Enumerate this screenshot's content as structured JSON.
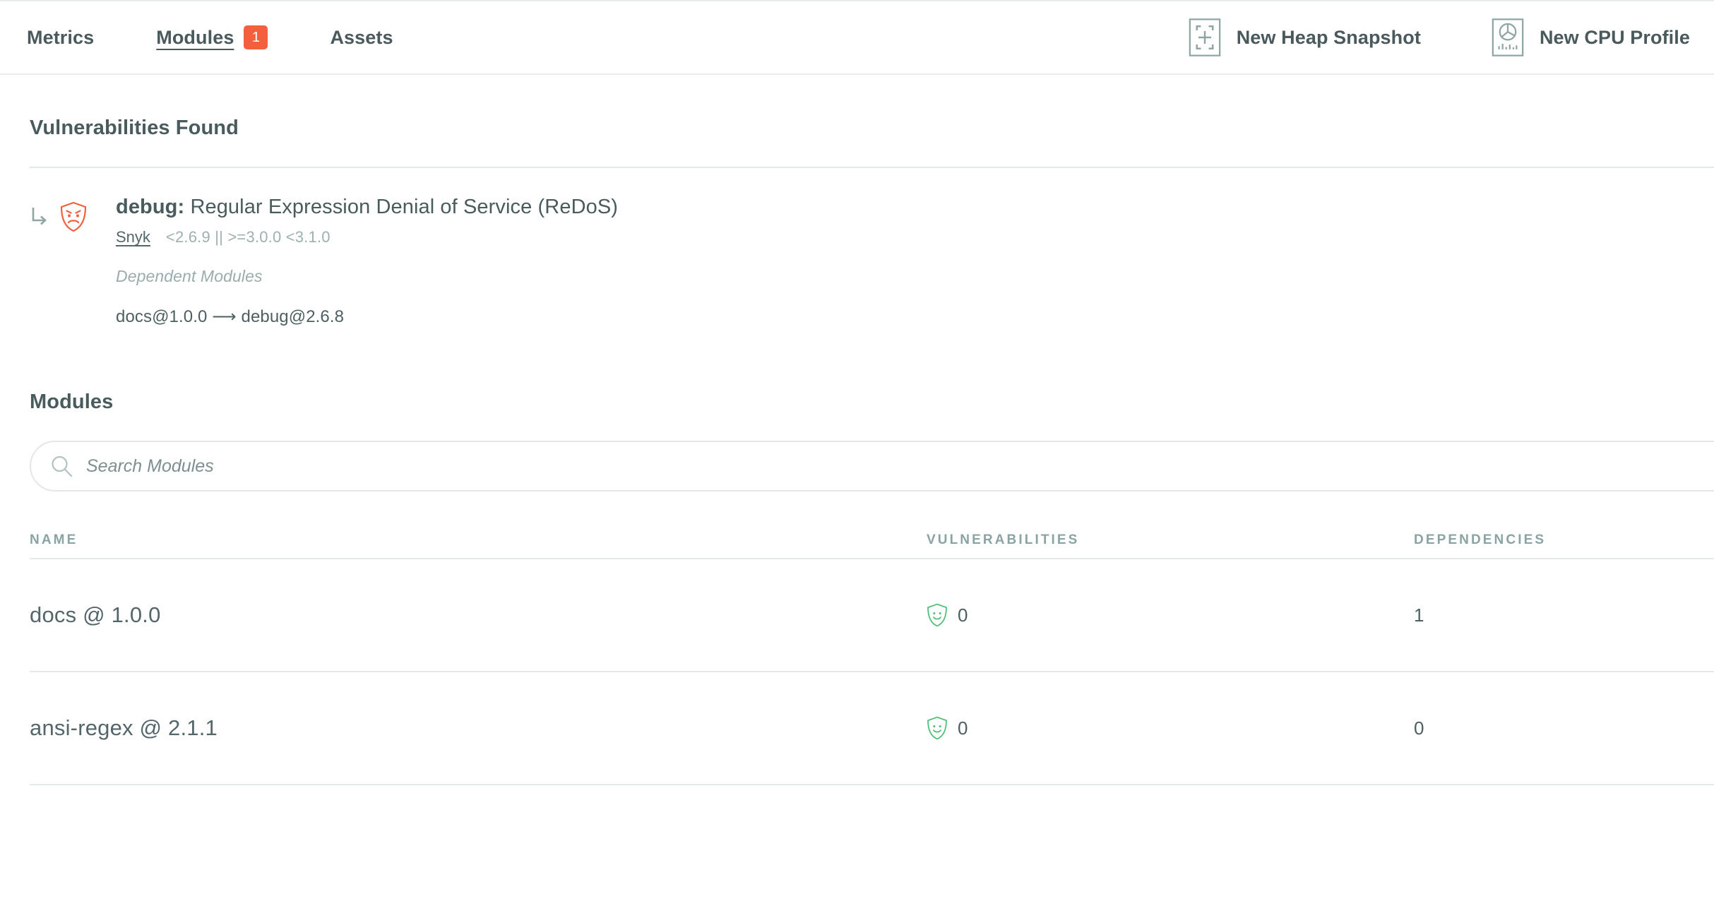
{
  "toolbar": {
    "tabs": [
      {
        "label": "Metrics",
        "active": false,
        "badge": null
      },
      {
        "label": "Modules",
        "active": true,
        "badge": "1"
      },
      {
        "label": "Assets",
        "active": false,
        "badge": null
      }
    ],
    "actions": [
      {
        "label": "New Heap Snapshot",
        "icon": "heap-snapshot-icon"
      },
      {
        "label": "New CPU Profile",
        "icon": "cpu-profile-icon"
      }
    ],
    "badge_color": "#f4603e"
  },
  "vulnerabilities_section": {
    "title": "Vulnerabilities Found",
    "items": [
      {
        "module": "debug",
        "separator": ":",
        "title": "Regular Expression Denial of Service (ReDoS)",
        "source": "Snyk",
        "version_range": "<2.6.9 || >=3.0.0 <3.1.0",
        "dependent_modules_label": "Dependent Modules",
        "paths": [
          {
            "from": "docs@1.0.0",
            "arrow": "⟶",
            "to": "debug@2.6.8"
          }
        ],
        "status_icon": "shield-angry-icon",
        "status_color": "#f4603e"
      }
    ]
  },
  "modules_section": {
    "title": "Modules",
    "search": {
      "placeholder": "Search Modules",
      "value": "",
      "icon": "search-icon"
    },
    "table": {
      "columns": [
        "NAME",
        "VULNERABILITIES",
        "DEPENDENCIES"
      ],
      "rows": [
        {
          "name": "docs @ 1.0.0",
          "vulnerabilities": "0",
          "vuln_icon": "shield-happy-icon",
          "dependencies": "1"
        },
        {
          "name": "ansi-regex @ 2.1.1",
          "vulnerabilities": "0",
          "vuln_icon": "shield-happy-icon",
          "dependencies": "0"
        }
      ]
    },
    "ok_color": "#4cbd72"
  }
}
